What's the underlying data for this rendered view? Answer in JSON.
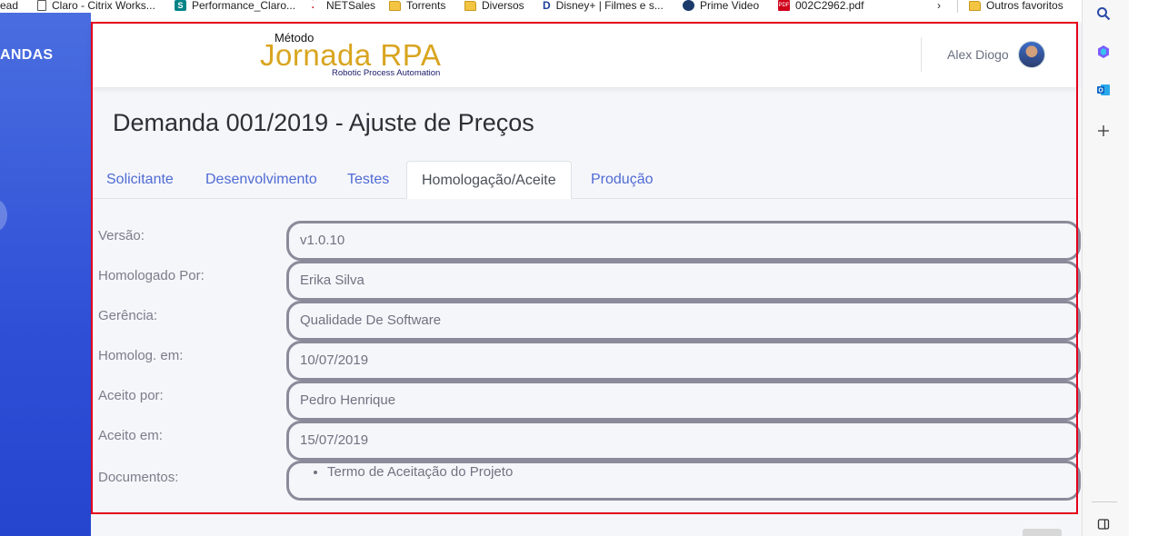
{
  "bookmarks": [
    {
      "label": "read",
      "icon": "none"
    },
    {
      "label": "Claro - Citrix Works...",
      "icon": "document-icon"
    },
    {
      "label": "Performance_Claro...",
      "icon": "sharepoint-icon"
    },
    {
      "label": "NETSales",
      "icon": "dots-icon"
    },
    {
      "label": "Torrents",
      "icon": "folder-icon"
    },
    {
      "label": "Diversos",
      "icon": "folder-icon"
    },
    {
      "label": "Disney+ | Filmes e s...",
      "icon": "disney-icon"
    },
    {
      "label": "Prime Video",
      "icon": "prime-icon"
    },
    {
      "label": "002C2962.pdf",
      "icon": "pdf-icon"
    },
    {
      "label": "Outros favoritos",
      "icon": "folder-icon"
    }
  ],
  "app_sidebar": {
    "brand": "ANDAS"
  },
  "header": {
    "logo_small": "Método",
    "logo_big": "Jornada RPA",
    "logo_tagline": "Robotic Process Automation",
    "user_name": "Alex Diogo"
  },
  "page": {
    "title": "Demanda 001/2019 - Ajuste de Preços",
    "tabs": [
      {
        "label": "Solicitante",
        "active": false
      },
      {
        "label": "Desenvolvimento",
        "active": false
      },
      {
        "label": "Testes",
        "active": false
      },
      {
        "label": "Homologação/Aceite",
        "active": true
      },
      {
        "label": "Produção",
        "active": false
      }
    ]
  },
  "form": {
    "fields": [
      {
        "label": "Versão:",
        "value": "v1.0.10"
      },
      {
        "label": "Homologado Por:",
        "value": "Erika Silva"
      },
      {
        "label": "Gerência:",
        "value": "Qualidade De Software"
      },
      {
        "label": "Homolog. em:",
        "value": "10/07/2019"
      },
      {
        "label": "Aceito por:",
        "value": "Pedro Henrique"
      },
      {
        "label": "Aceito em:",
        "value": "15/07/2019"
      }
    ],
    "documents_label": "Documentos:",
    "documents": [
      "Termo de Aceitação do Projeto"
    ]
  },
  "colors": {
    "accent": "#4f6bd3",
    "logo": "#d9a520",
    "highlight_border": "#e3001b",
    "sidebar": "#3355d8"
  }
}
